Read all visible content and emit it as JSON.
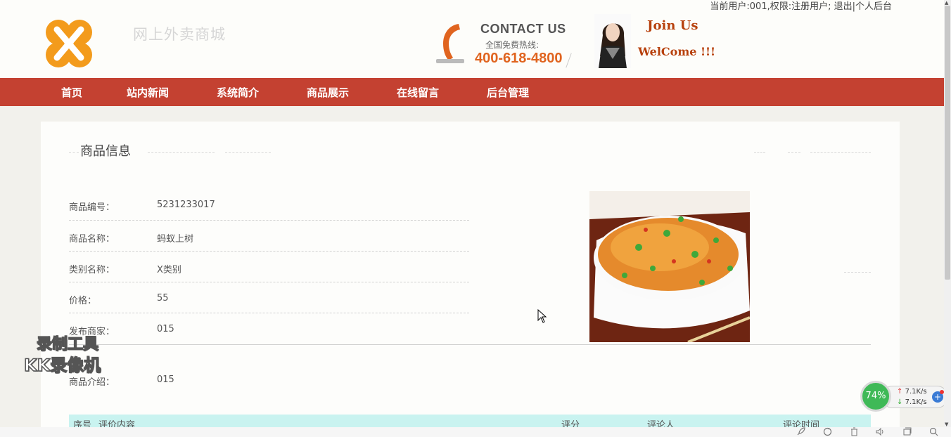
{
  "header": {
    "user_info": "当前用户:001,权限:注册用户; 退出|个人后台",
    "site_title": "网上外卖商城",
    "contact_title": "CONTACT US",
    "contact_sub": "全国免费热线:",
    "contact_phone": "400-618-4800",
    "join": "Join Us",
    "welcome": "WelCome !!!"
  },
  "nav": {
    "items": [
      "首页",
      "站内新闻",
      "系统简介",
      "商品展示",
      "在线留言",
      "后台管理"
    ]
  },
  "product": {
    "section_title": "商品信息",
    "fields": [
      {
        "label": "商品编号：",
        "value": "5231233017"
      },
      {
        "label": "商品名称：",
        "value": "蚂蚁上树"
      },
      {
        "label": "类别名称：",
        "value": "X类别"
      },
      {
        "label": "价格：",
        "value": "55"
      },
      {
        "label": "发布商家：",
        "value": "015"
      }
    ],
    "intro_label": "商品介绍：",
    "intro_value": "015"
  },
  "reviews_table": {
    "headers": [
      "序号",
      "评价内容",
      "评分",
      "评论人",
      "评论时间"
    ]
  },
  "watermark": {
    "line1": "录制工具",
    "line2": "KK录像机"
  },
  "net_widget": {
    "percent": "74%",
    "up": "7.1K/s",
    "down": "7.1K/s"
  },
  "colors": {
    "nav_bg": "#c44131",
    "phone": "#e0641f",
    "join": "#b7400c",
    "table_header": "#c9f3f0"
  }
}
